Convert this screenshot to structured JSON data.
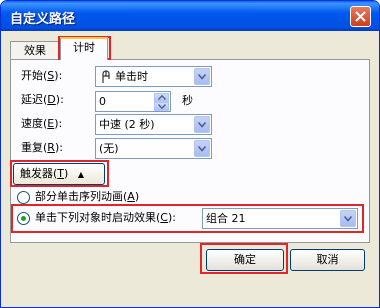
{
  "window": {
    "title": "自定义路径"
  },
  "tabs": [
    {
      "label": "效果"
    },
    {
      "label": "计时"
    }
  ],
  "start": {
    "label": "开始(",
    "key": "S",
    "tail": "):",
    "value": "单击时"
  },
  "delay": {
    "label": "延迟(",
    "key": "D",
    "tail": "):",
    "value": "0",
    "unit": "秒"
  },
  "speed": {
    "label": "速度(",
    "key": "E",
    "tail": "):",
    "value": "中速 (2 秒)"
  },
  "repeat": {
    "label": "重复(",
    "key": "R",
    "tail": "):",
    "value": "(无)"
  },
  "trigger": {
    "label": "触发器(",
    "key": "T",
    "tail": ")",
    "arrow": "▲"
  },
  "option_sequence": {
    "label": "部分单击序列动画(",
    "key": "A",
    "tail": ")",
    "selected": false
  },
  "option_object": {
    "label": "单击下列对象时启动效果(",
    "key": "C",
    "tail": "):",
    "selected": true,
    "value": "组合 21"
  },
  "buttons": {
    "ok": "确定",
    "cancel": "取消"
  },
  "colors": {
    "highlight": "#e0262b",
    "title_bar": "#0054e3",
    "dialog_bg": "#ece9d8"
  },
  "icons": {
    "close": "close-icon",
    "start": "mouse-click-icon",
    "dropdown": "chevron-down-icon"
  }
}
